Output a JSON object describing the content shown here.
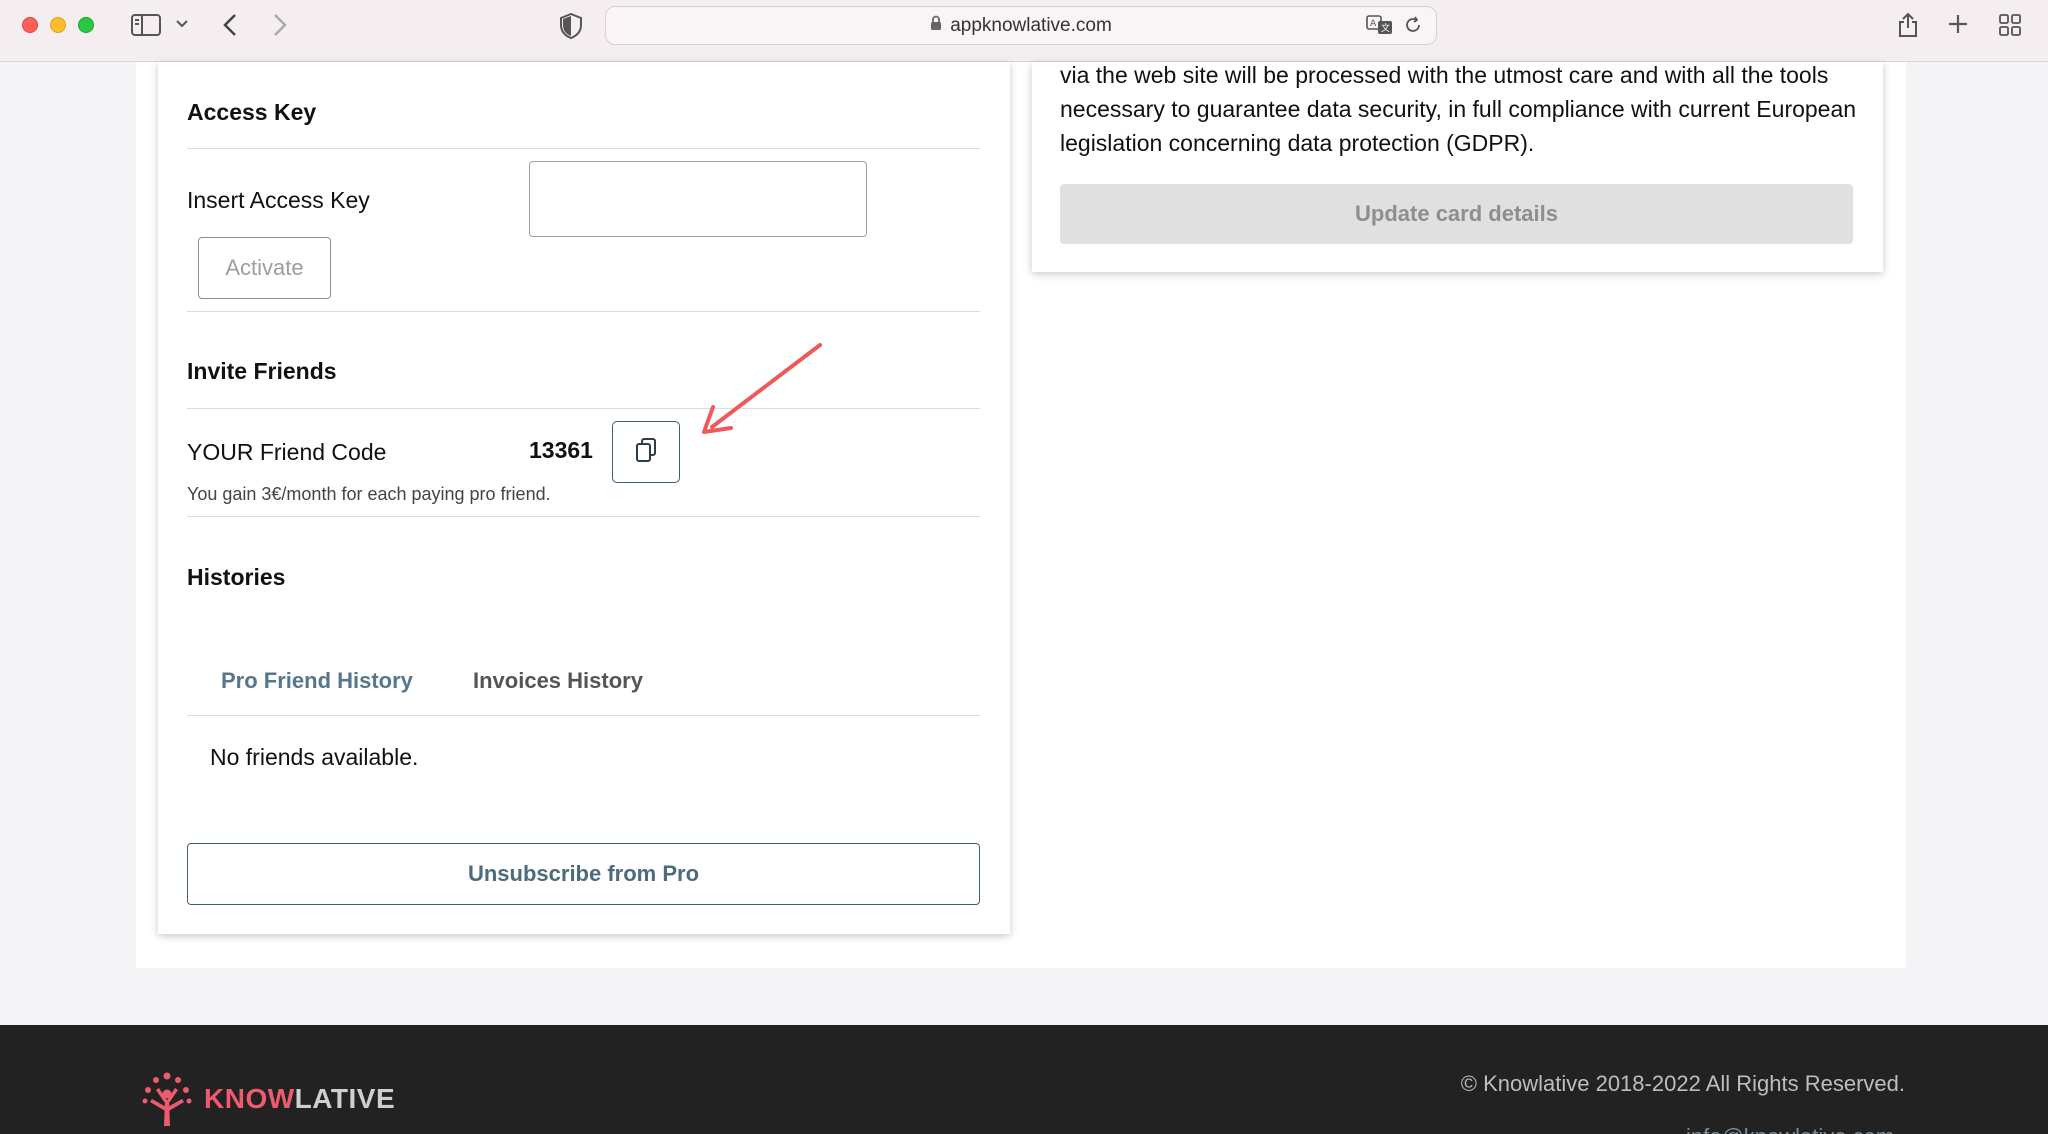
{
  "browser": {
    "url": "appknowlative.com"
  },
  "access_key": {
    "title": "Access Key",
    "input_label": "Insert Access Key",
    "input_value": "",
    "input_placeholder": "",
    "activate_label": "Activate"
  },
  "invite": {
    "title": "Invite Friends",
    "code_label": "YOUR Friend Code",
    "code_value": "13361",
    "hint": "You gain 3€/month for each paying pro friend."
  },
  "histories": {
    "title": "Histories",
    "tabs": [
      {
        "label": "Pro Friend History",
        "active": true
      },
      {
        "label": "Invoices History",
        "active": false
      }
    ],
    "empty_message": "No friends available."
  },
  "unsubscribe_label": "Unsubscribe from Pro",
  "payment": {
    "gdpr_text": "via the web site will be processed with the utmost care and with all the tools necessary to guarantee data security, in full compliance with current European legislation concerning data protection (GDPR).",
    "update_label": "Update card details"
  },
  "footer": {
    "logo_part1": "KNOW",
    "logo_part2": "LATIVE",
    "copyright": "© Knowlative 2018-2022 All Rights Reserved.",
    "email": "info@knowlative.com"
  },
  "colors": {
    "accent": "#56778b",
    "logo_pink": "#ee5b6e",
    "annotation_arrow": "#ee5a5a",
    "footer_bg": "#222222"
  }
}
